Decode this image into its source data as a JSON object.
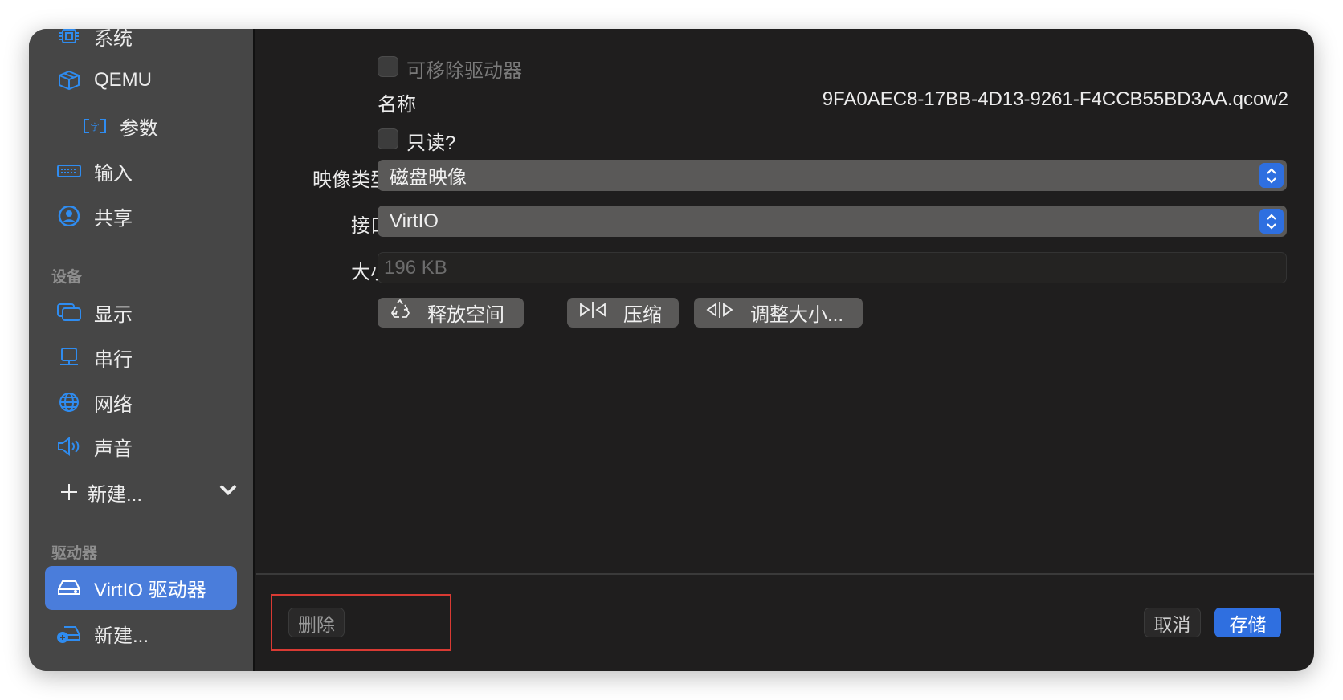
{
  "sidebar": {
    "items": [
      {
        "label": "系统",
        "icon": "cpu-icon"
      },
      {
        "label": "QEMU",
        "icon": "cube-icon"
      },
      {
        "label": "参数",
        "icon": "text-field-icon"
      },
      {
        "label": "输入",
        "icon": "keyboard-icon"
      },
      {
        "label": "共享",
        "icon": "person-circle-icon"
      },
      {
        "label": "显示",
        "icon": "display-icon"
      },
      {
        "label": "串行",
        "icon": "terminal-monitor-icon"
      },
      {
        "label": "网络",
        "icon": "globe-icon"
      },
      {
        "label": "声音",
        "icon": "speaker-icon"
      }
    ],
    "devices_header": "设备",
    "new_device": "新建...",
    "drives_header": "驱动器",
    "selected_drive": "VirtIO 驱动器",
    "new_drive": "新建..."
  },
  "form": {
    "removable_label": "可移除驱动器",
    "name_label": "名称",
    "name_value": "9FA0AEC8-17BB-4D13-9261-F4CCB55BD3AA.qcow2",
    "readonly_label": "只读?",
    "image_type_label": "映像类型",
    "image_type_value": "磁盘映像",
    "interface_label": "接口",
    "interface_value": "VirtIO",
    "size_label": "大小",
    "size_value": "196 KB",
    "reclaim_label": "释放空间",
    "compress_label": "压缩",
    "resize_label": "调整大小..."
  },
  "footer": {
    "delete_label": "删除",
    "cancel_label": "取消",
    "save_label": "存储"
  },
  "colors": {
    "accent": "#4a7ddb",
    "save": "#2f6fe0",
    "highlight_box": "#d93a33"
  }
}
